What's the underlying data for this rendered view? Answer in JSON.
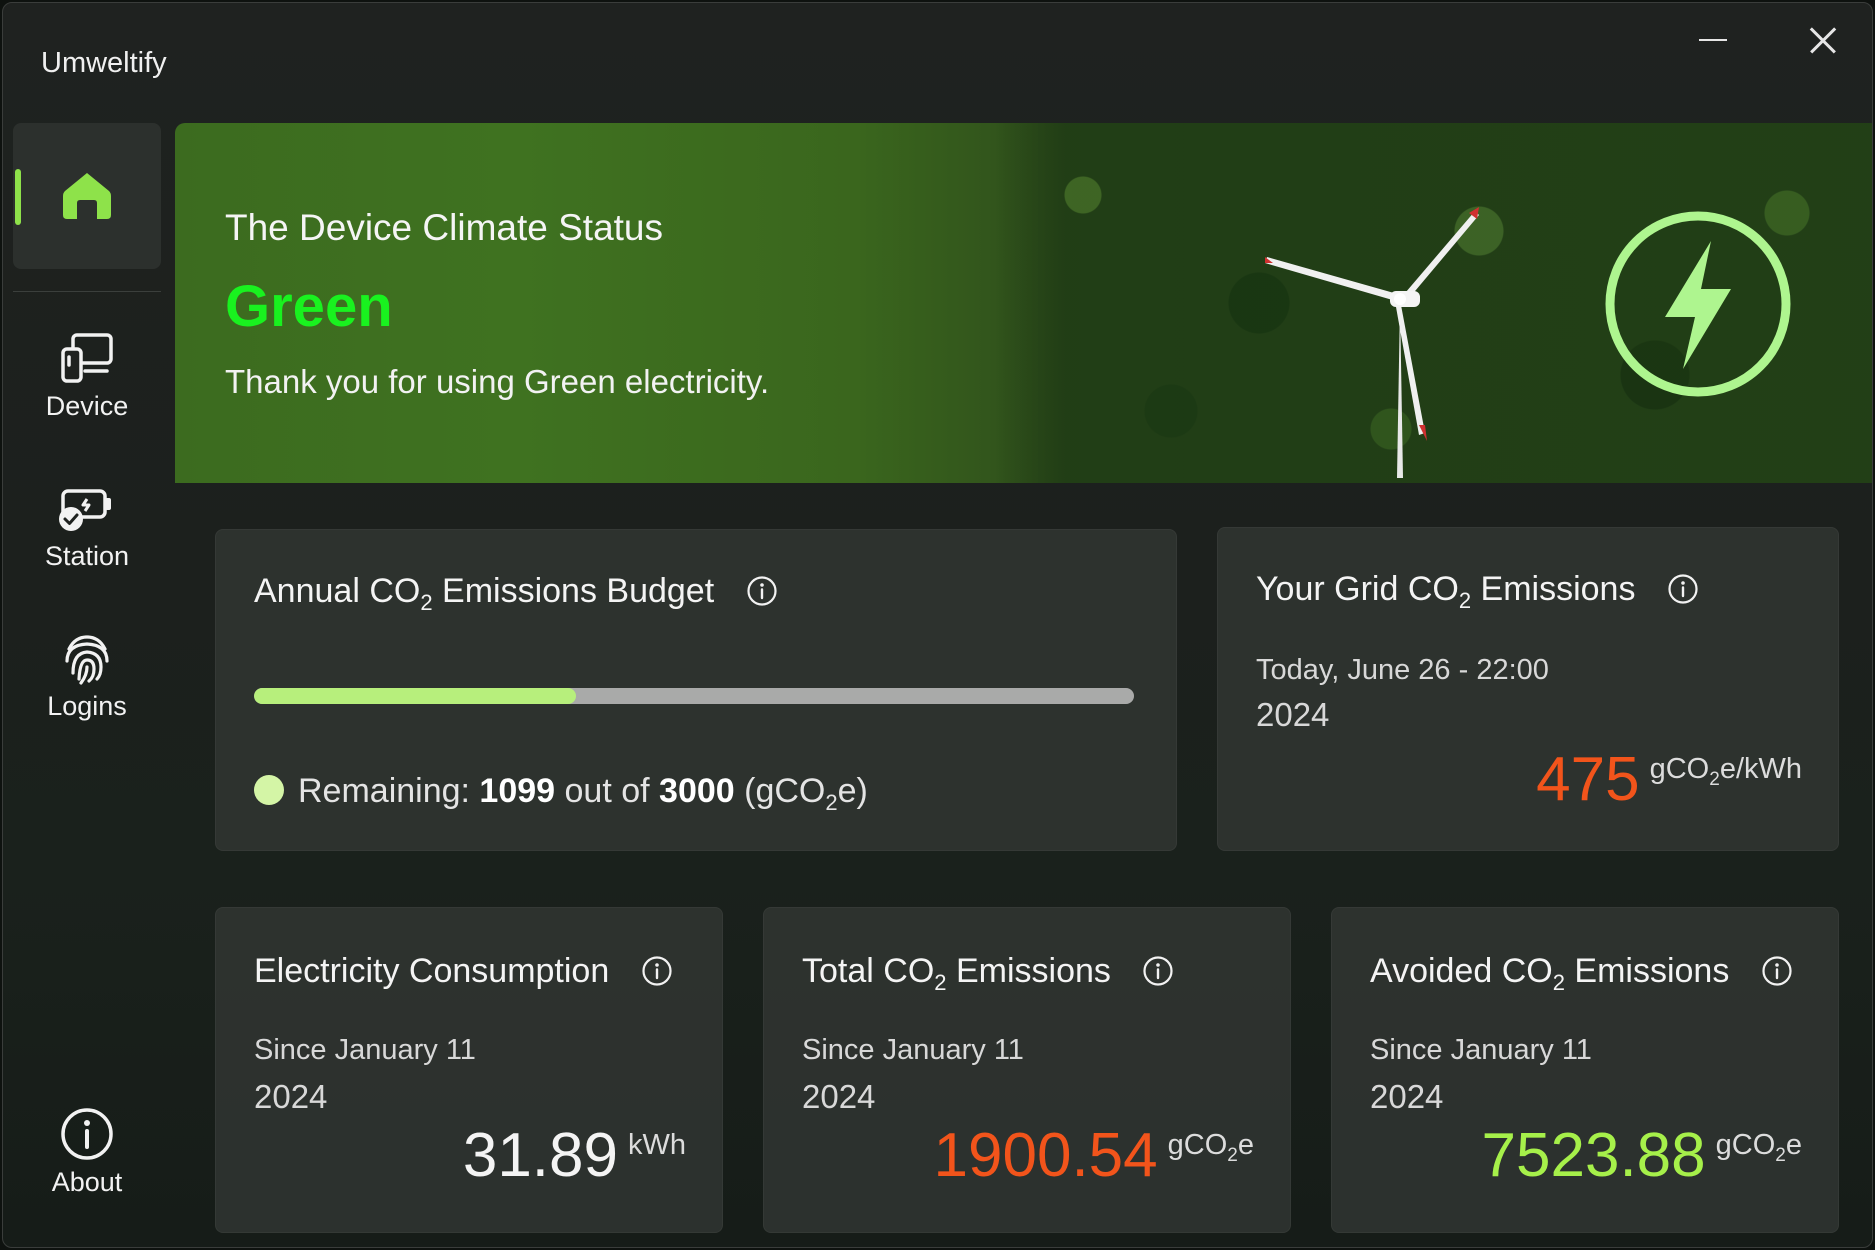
{
  "app": {
    "title": "Umweltify"
  },
  "sidebar": {
    "items": [
      {
        "label": "",
        "icon": "home-icon"
      },
      {
        "label": "Device",
        "icon": "device-icon"
      },
      {
        "label": "Station",
        "icon": "station-icon"
      },
      {
        "label": "Logins",
        "icon": "fingerprint-icon"
      },
      {
        "label": "About",
        "icon": "info-icon"
      }
    ]
  },
  "hero": {
    "title": "The Device Climate Status",
    "status": "Green",
    "message": "Thank you for using Green electricity."
  },
  "budget": {
    "title_pre": "Annual CO",
    "title_sub": "2",
    "title_post": " Emissions Budget",
    "progress_fraction": 0.3663,
    "remaining_label": "Remaining: ",
    "remaining_value": "1099",
    "out_of": " out of ",
    "total": "3000",
    "unit_pre": " (gCO",
    "unit_sub": "2",
    "unit_post": "e)"
  },
  "grid": {
    "title_pre": "Your Grid CO",
    "title_sub": "2",
    "title_post": " Emissions",
    "date_line": "Today, June 26 - 22:00",
    "year": "2024",
    "value": "475",
    "unit_pre": "gCO",
    "unit_sub": "2",
    "unit_post": "e/kWh"
  },
  "electricity": {
    "title": "Electricity Consumption",
    "since": "Since January 11",
    "year": "2024",
    "value": "31.89",
    "unit": "kWh"
  },
  "total": {
    "title_pre": "Total CO",
    "title_sub": "2",
    "title_post": " Emissions",
    "since": "Since January 11",
    "year": "2024",
    "value": "1900.54",
    "unit_pre": "gCO",
    "unit_sub": "2",
    "unit_post": "e"
  },
  "avoided": {
    "title_pre": "Avoided CO",
    "title_sub": "2",
    "title_post": " Emissions",
    "since": "Since January 11",
    "year": "2024",
    "value": "7523.88",
    "unit_pre": "gCO",
    "unit_sub": "2",
    "unit_post": "e"
  },
  "colors": {
    "accent_green": "#8ee24a",
    "status_green": "#19f21f",
    "emission_orange": "#f2541b",
    "avoided_green": "#a6f04a",
    "progress_fill": "#b7ef7c",
    "bolt_ring": "#aef58f"
  }
}
